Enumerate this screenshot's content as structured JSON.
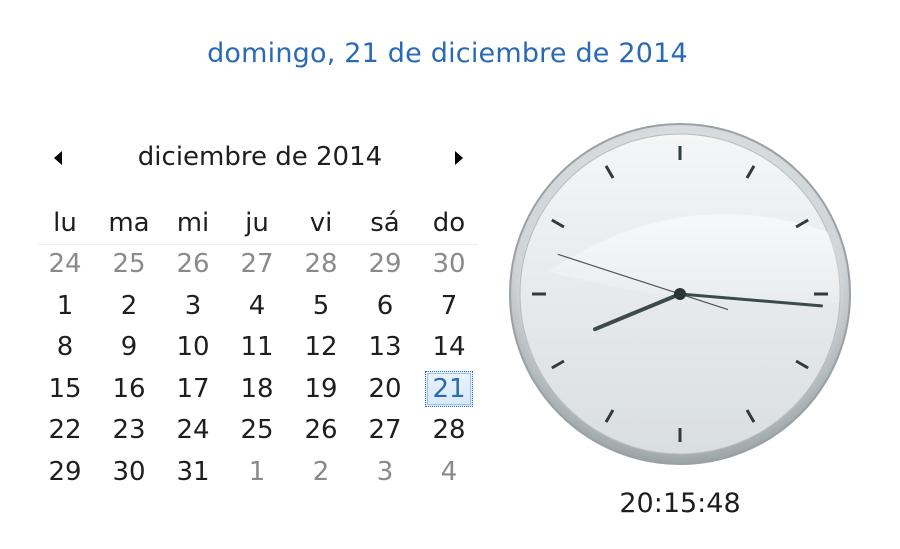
{
  "header": {
    "full_date": "domingo, 21 de diciembre de 2014"
  },
  "calendar": {
    "month_label": "diciembre de 2014",
    "prev_icon": "triangle-left",
    "next_icon": "triangle-right",
    "weekdays": [
      "lu",
      "ma",
      "mi",
      "ju",
      "vi",
      "sá",
      "do"
    ],
    "weeks": [
      [
        "24",
        "25",
        "26",
        "27",
        "28",
        "29",
        "30"
      ],
      [
        "1",
        "2",
        "3",
        "4",
        "5",
        "6",
        "7"
      ],
      [
        "8",
        "9",
        "10",
        "11",
        "12",
        "13",
        "14"
      ],
      [
        "15",
        "16",
        "17",
        "18",
        "19",
        "20",
        "21"
      ],
      [
        "22",
        "23",
        "24",
        "25",
        "26",
        "27",
        "28"
      ],
      [
        "29",
        "30",
        "31",
        "1",
        "2",
        "3",
        "4"
      ]
    ],
    "other_month_days": {
      "first_week_count": 7,
      "last_week_from": 3
    },
    "selected_day": "21",
    "colors": {
      "accent": "#2a6ab5",
      "muted": "#8a8a8a",
      "text": "#1e1e1e"
    }
  },
  "clock": {
    "time": "20:15:48",
    "hours": 20,
    "minutes": 15,
    "seconds": 48,
    "colors": {
      "face": "#e6eaec",
      "rim": "#c4c9cc",
      "hands": "#3c4a4e"
    }
  }
}
